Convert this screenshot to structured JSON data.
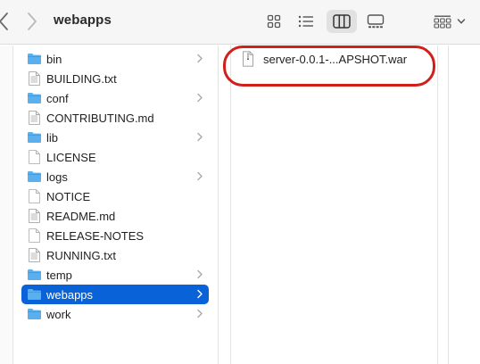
{
  "window": {
    "title": "webapps"
  },
  "toolbar": {
    "view_buttons": [
      {
        "name": "icon-view-button",
        "icon": "grid-icon"
      },
      {
        "name": "list-view-button",
        "icon": "list-icon"
      },
      {
        "name": "column-view-button",
        "icon": "columns-icon",
        "active": true
      },
      {
        "name": "gallery-view-button",
        "icon": "gallery-icon"
      }
    ],
    "group_button_icon": "grid-group-icon"
  },
  "sidebar_column": {
    "items": [
      {
        "label": "bin",
        "kind": "folder",
        "expandable": true
      },
      {
        "label": "BUILDING.txt",
        "kind": "text-file",
        "expandable": false
      },
      {
        "label": "conf",
        "kind": "folder",
        "expandable": true
      },
      {
        "label": "CONTRIBUTING.md",
        "kind": "text-file",
        "expandable": false
      },
      {
        "label": "lib",
        "kind": "folder",
        "expandable": true
      },
      {
        "label": "LICENSE",
        "kind": "plain-file",
        "expandable": false
      },
      {
        "label": "logs",
        "kind": "folder",
        "expandable": true
      },
      {
        "label": "NOTICE",
        "kind": "plain-file",
        "expandable": false
      },
      {
        "label": "README.md",
        "kind": "text-file",
        "expandable": false
      },
      {
        "label": "RELEASE-NOTES",
        "kind": "plain-file",
        "expandable": false
      },
      {
        "label": "RUNNING.txt",
        "kind": "text-file",
        "expandable": false
      },
      {
        "label": "temp",
        "kind": "folder",
        "expandable": true
      },
      {
        "label": "webapps",
        "kind": "folder",
        "expandable": true,
        "selected": true
      },
      {
        "label": "work",
        "kind": "folder",
        "expandable": true
      }
    ]
  },
  "content_column": {
    "file": {
      "label": "server-0.0.1-...APSHOT.war",
      "kind": "archive-file"
    }
  },
  "colors": {
    "selection": "#0a62d8",
    "folder": "#5ab0ef",
    "annotation_ring": "#d0201a"
  }
}
